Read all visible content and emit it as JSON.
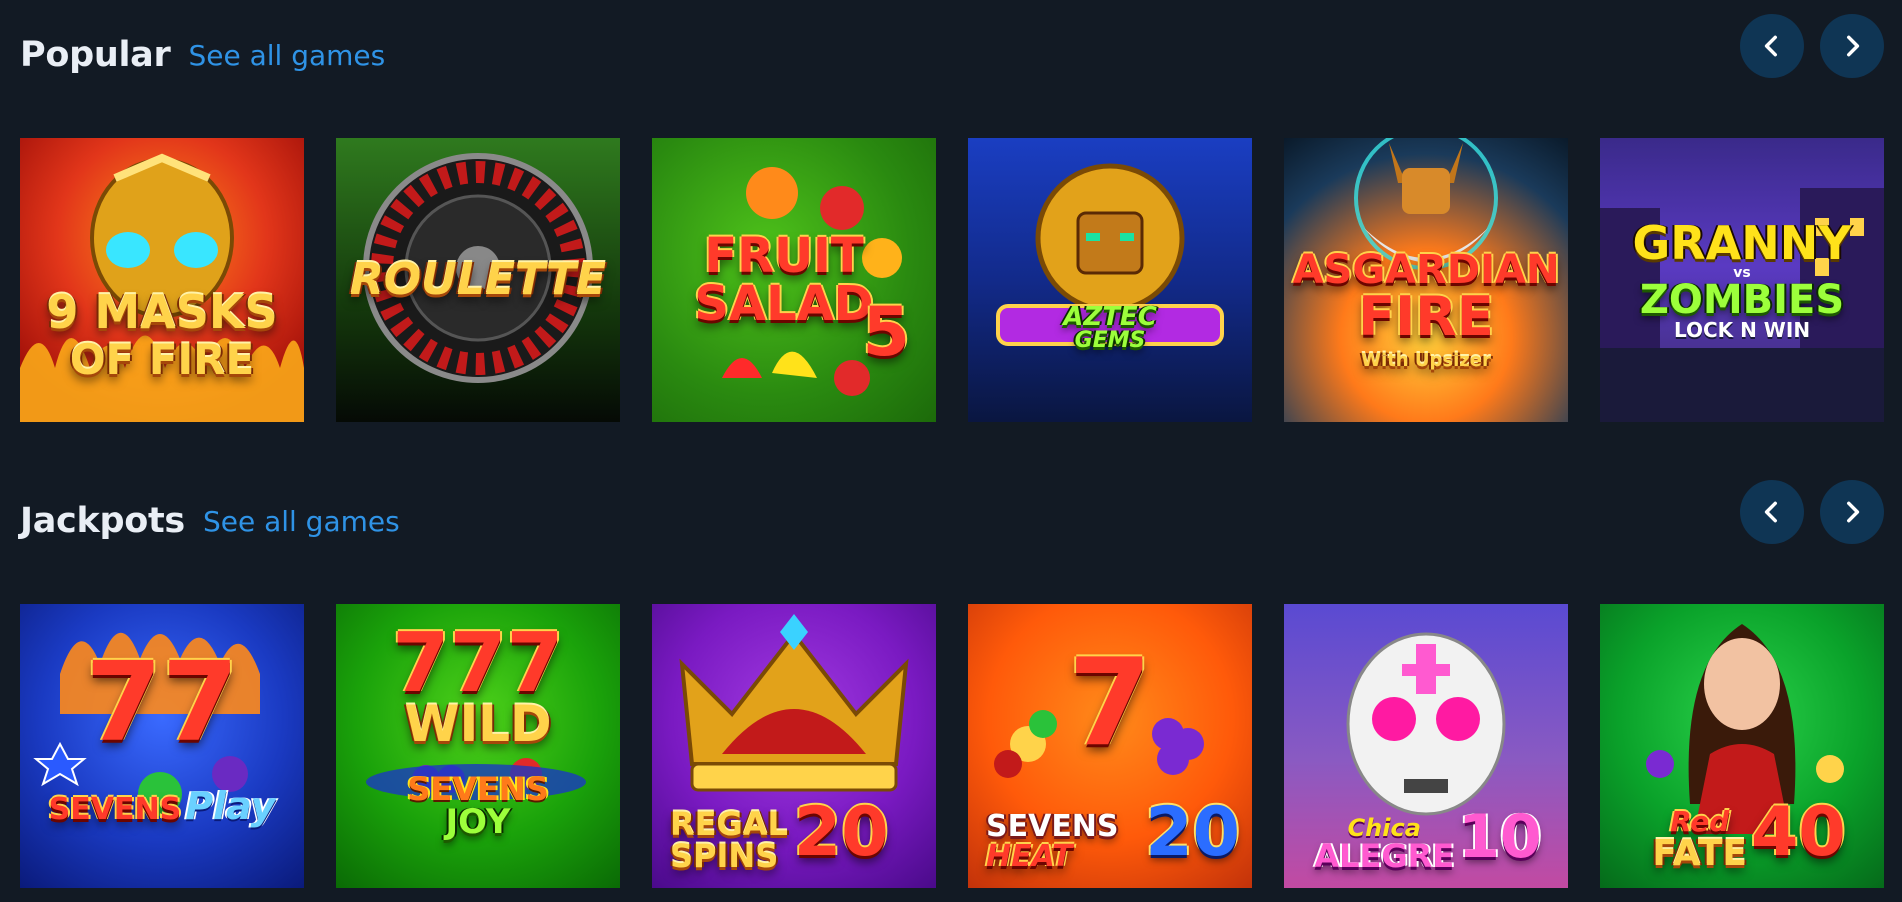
{
  "sections": [
    {
      "title": "Popular",
      "see_all": "See all games",
      "games": [
        {
          "l1": "9 MASKS",
          "l2": "OF FIRE"
        },
        {
          "l1": "ROULETTE"
        },
        {
          "l1": "FRUIT",
          "l2": "SALAD",
          "n": "5"
        },
        {
          "l1": "AZTEC",
          "l2": "GEMS"
        },
        {
          "l1": "ASGARDIAN",
          "l2": "FIRE",
          "l3": "With Upsizer"
        },
        {
          "l1": "GRANNY",
          "vs": "vs",
          "l2": "ZOMBIES",
          "l3": "LOCK N WIN"
        }
      ]
    },
    {
      "title": "Jackpots",
      "see_all": "See all games",
      "games": [
        {
          "n": "77",
          "l1": "SEVENS",
          "l2": "Play"
        },
        {
          "n": "777",
          "l1": "WILD",
          "l2": "SEVENS",
          "l3": "JOY"
        },
        {
          "l1": "REGAL",
          "l2": "SPINS",
          "n": "20"
        },
        {
          "n": "7",
          "l1": "SEVENS",
          "l2": "HEAT",
          "n2": "20"
        },
        {
          "l1": "Chica",
          "l2": "ALEGRE",
          "n": "10"
        },
        {
          "l1": "Red",
          "l2": "FATE",
          "n": "40"
        }
      ]
    }
  ],
  "icons": {
    "prev": "chevron-left-icon",
    "next": "chevron-right-icon"
  }
}
